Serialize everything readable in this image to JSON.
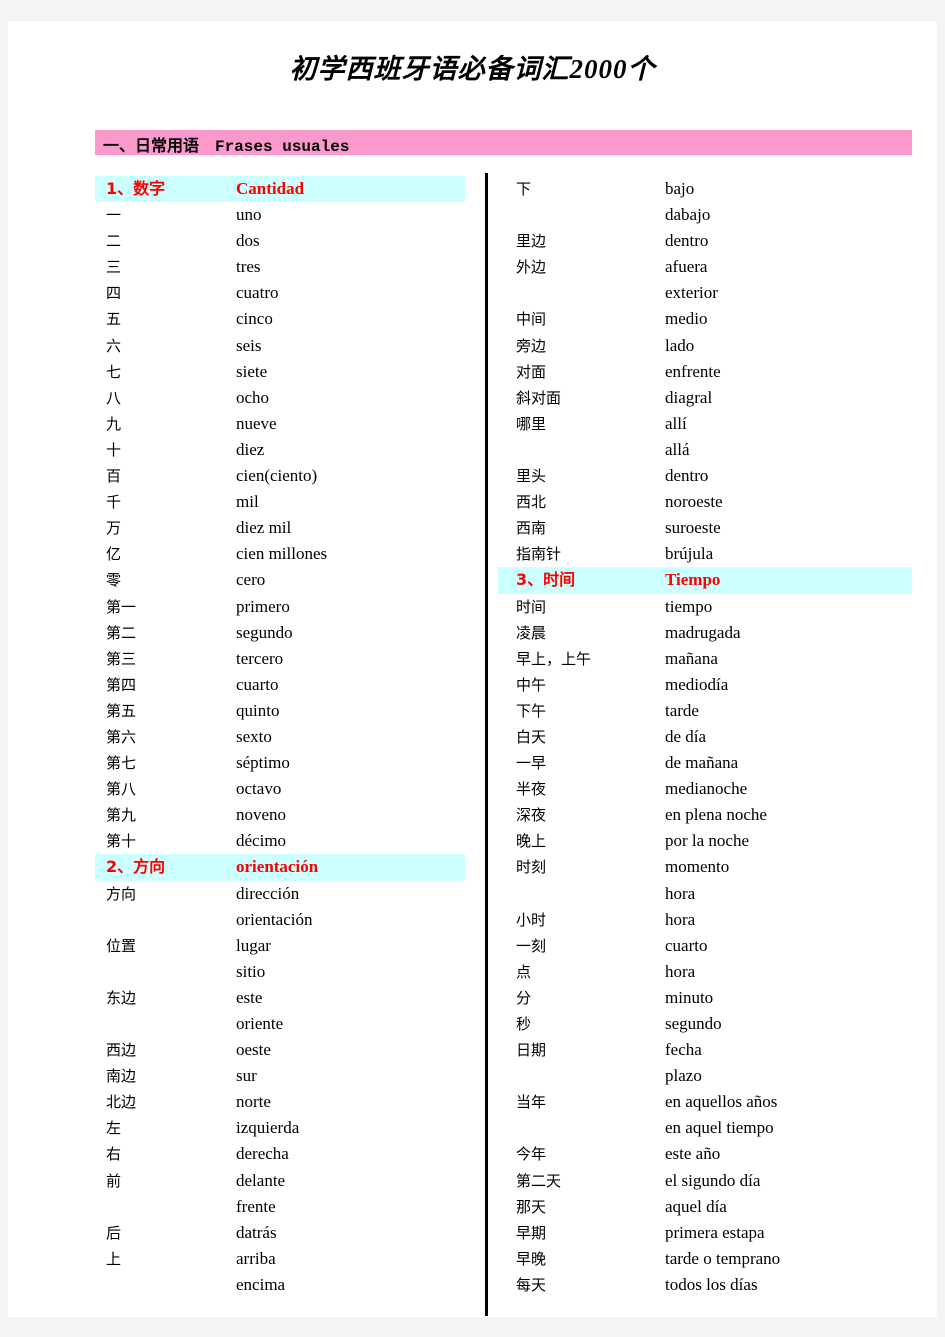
{
  "document": {
    "title": "初学西班牙语必备词汇2000个",
    "chapter": "一、日常用语　Frases usuales"
  },
  "colors": {
    "chapter_bar": "#fb99cc",
    "section_bar": "#ccffff",
    "section_text": "#ff0000",
    "page_background": "#ffffff",
    "canvas_background": "#f4f4f4",
    "divider": "#000000"
  },
  "columns": {
    "left": [
      {
        "type": "section",
        "cn": "1、数字",
        "es": "Cantidad"
      },
      {
        "type": "entry",
        "cn": "一",
        "es": "uno"
      },
      {
        "type": "entry",
        "cn": "二",
        "es": "dos"
      },
      {
        "type": "entry",
        "cn": "三",
        "es": "tres"
      },
      {
        "type": "entry",
        "cn": "四",
        "es": "cuatro"
      },
      {
        "type": "entry",
        "cn": "五",
        "es": "cinco"
      },
      {
        "type": "entry",
        "cn": "六",
        "es": "seis"
      },
      {
        "type": "entry",
        "cn": "七",
        "es": "siete"
      },
      {
        "type": "entry",
        "cn": "八",
        "es": "ocho"
      },
      {
        "type": "entry",
        "cn": "九",
        "es": "nueve"
      },
      {
        "type": "entry",
        "cn": "十",
        "es": "diez"
      },
      {
        "type": "entry",
        "cn": "百",
        "es": "cien(ciento)"
      },
      {
        "type": "entry",
        "cn": "千",
        "es": "mil"
      },
      {
        "type": "entry",
        "cn": "万",
        "es": "diez mil"
      },
      {
        "type": "entry",
        "cn": "亿",
        "es": "cien millones"
      },
      {
        "type": "entry",
        "cn": "零",
        "es": "cero"
      },
      {
        "type": "entry",
        "cn": "第一",
        "es": "primero"
      },
      {
        "type": "entry",
        "cn": "第二",
        "es": "segundo"
      },
      {
        "type": "entry",
        "cn": "第三",
        "es": "tercero"
      },
      {
        "type": "entry",
        "cn": "第四",
        "es": "cuarto"
      },
      {
        "type": "entry",
        "cn": "第五",
        "es": "quinto"
      },
      {
        "type": "entry",
        "cn": "第六",
        "es": "sexto"
      },
      {
        "type": "entry",
        "cn": "第七",
        "es": "séptimo"
      },
      {
        "type": "entry",
        "cn": "第八",
        "es": "octavo"
      },
      {
        "type": "entry",
        "cn": "第九",
        "es": "noveno"
      },
      {
        "type": "entry",
        "cn": "第十",
        "es": "décimo"
      },
      {
        "type": "section",
        "cn": "2、方向",
        "es": "orientación"
      },
      {
        "type": "entry",
        "cn": "方向",
        "es": "dirección"
      },
      {
        "type": "entry",
        "cn": "",
        "es": "orientación"
      },
      {
        "type": "entry",
        "cn": "位置",
        "es": "lugar"
      },
      {
        "type": "entry",
        "cn": "",
        "es": "sitio"
      },
      {
        "type": "entry",
        "cn": "东边",
        "es": "este"
      },
      {
        "type": "entry",
        "cn": "",
        "es": "oriente"
      },
      {
        "type": "entry",
        "cn": "西边",
        "es": "oeste"
      },
      {
        "type": "entry",
        "cn": "南边",
        "es": "sur"
      },
      {
        "type": "entry",
        "cn": "北边",
        "es": "norte"
      },
      {
        "type": "entry",
        "cn": "左",
        "es": "izquierda"
      },
      {
        "type": "entry",
        "cn": "右",
        "es": "derecha"
      },
      {
        "type": "entry",
        "cn": "前",
        "es": "delante"
      },
      {
        "type": "entry",
        "cn": "",
        "es": "frente"
      },
      {
        "type": "entry",
        "cn": "后",
        "es": "datrás"
      },
      {
        "type": "entry",
        "cn": "上",
        "es": "arriba"
      },
      {
        "type": "entry",
        "cn": "",
        "es": "encima"
      }
    ],
    "right": [
      {
        "type": "entry",
        "cn": "下",
        "es": "bajo"
      },
      {
        "type": "entry",
        "cn": "",
        "es": "dabajo"
      },
      {
        "type": "entry",
        "cn": "里边",
        "es": "dentro"
      },
      {
        "type": "entry",
        "cn": "外边",
        "es": "afuera"
      },
      {
        "type": "entry",
        "cn": "",
        "es": "exterior"
      },
      {
        "type": "entry",
        "cn": "中间",
        "es": "medio"
      },
      {
        "type": "entry",
        "cn": "旁边",
        "es": "lado"
      },
      {
        "type": "entry",
        "cn": "对面",
        "es": "enfrente"
      },
      {
        "type": "entry",
        "cn": "斜对面",
        "es": "diagral"
      },
      {
        "type": "entry",
        "cn": "哪里",
        "es": "allí"
      },
      {
        "type": "entry",
        "cn": "",
        "es": "allá"
      },
      {
        "type": "entry",
        "cn": "里头",
        "es": "dentro"
      },
      {
        "type": "entry",
        "cn": "西北",
        "es": "noroeste"
      },
      {
        "type": "entry",
        "cn": "西南",
        "es": "suroeste"
      },
      {
        "type": "entry",
        "cn": "指南针",
        "es": "brújula"
      },
      {
        "type": "section",
        "cn": "3、时间",
        "es": "Tiempo"
      },
      {
        "type": "entry",
        "cn": "时间",
        "es": "tiempo"
      },
      {
        "type": "entry",
        "cn": "凌晨",
        "es": "madrugada"
      },
      {
        "type": "entry",
        "cn": "早上，上午",
        "es": "mañana"
      },
      {
        "type": "entry",
        "cn": "中午",
        "es": "mediodía"
      },
      {
        "type": "entry",
        "cn": "下午",
        "es": "tarde"
      },
      {
        "type": "entry",
        "cn": "白天",
        "es": "de día"
      },
      {
        "type": "entry",
        "cn": "一早",
        "es": "de mañana"
      },
      {
        "type": "entry",
        "cn": "半夜",
        "es": "medianoche"
      },
      {
        "type": "entry",
        "cn": "深夜",
        "es": "en plena noche"
      },
      {
        "type": "entry",
        "cn": "晚上",
        "es": "por la noche"
      },
      {
        "type": "entry",
        "cn": "时刻",
        "es": "momento"
      },
      {
        "type": "entry",
        "cn": "",
        "es": "hora"
      },
      {
        "type": "entry",
        "cn": "小时",
        "es": "hora"
      },
      {
        "type": "entry",
        "cn": "一刻",
        "es": "cuarto"
      },
      {
        "type": "entry",
        "cn": "点",
        "es": "hora"
      },
      {
        "type": "entry",
        "cn": "分",
        "es": "minuto"
      },
      {
        "type": "entry",
        "cn": "秒",
        "es": "segundo"
      },
      {
        "type": "entry",
        "cn": "日期",
        "es": "fecha"
      },
      {
        "type": "entry",
        "cn": "",
        "es": "plazo"
      },
      {
        "type": "entry",
        "cn": "当年",
        "es": "en aquellos años"
      },
      {
        "type": "entry",
        "cn": "",
        "es": "en aquel tiempo"
      },
      {
        "type": "entry",
        "cn": "今年",
        "es": "este año"
      },
      {
        "type": "entry",
        "cn": "第二天",
        "es": "el sigundo día"
      },
      {
        "type": "entry",
        "cn": "那天",
        "es": "aquel día"
      },
      {
        "type": "entry",
        "cn": "早期",
        "es": "primera estapa"
      },
      {
        "type": "entry",
        "cn": "早晚",
        "es": "tarde o temprano"
      },
      {
        "type": "entry",
        "cn": "每天",
        "es": "todos los días"
      }
    ]
  }
}
